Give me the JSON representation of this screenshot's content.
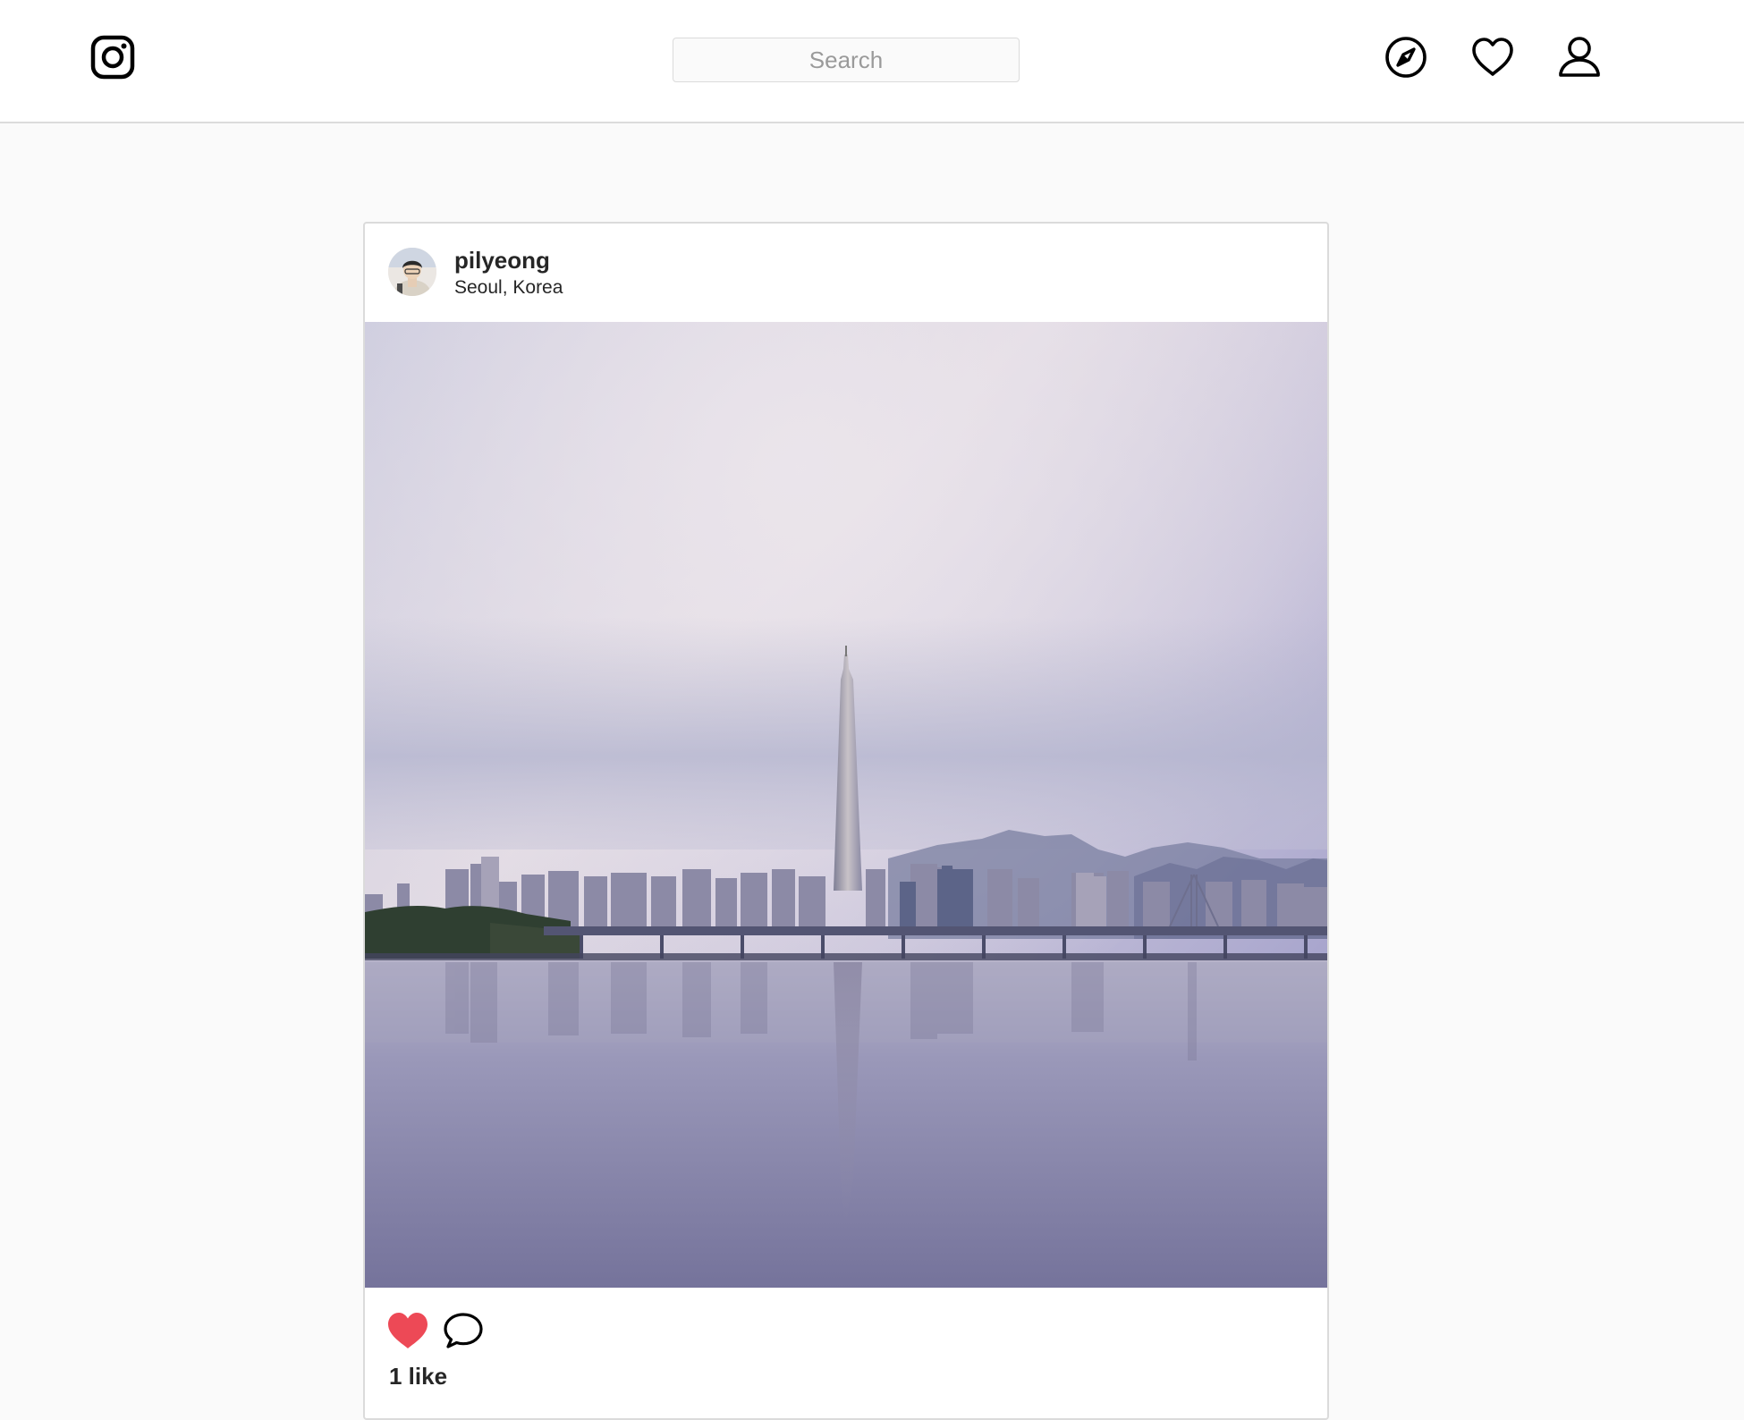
{
  "header": {
    "logo_icon": "instagram-logo-icon",
    "search": {
      "placeholder": "Search",
      "value": ""
    },
    "nav_icons": [
      "compass-icon",
      "heart-outline-icon",
      "user-icon"
    ]
  },
  "post": {
    "username": "pilyeong",
    "location": "Seoul, Korea",
    "image": "city skyline with tall tower reflected in river",
    "actions": {
      "liked": true,
      "like_color": "#ed4956",
      "like_icon": "heart-filled-icon",
      "comment_icon": "comment-icon"
    },
    "likes_text": "1 like"
  }
}
